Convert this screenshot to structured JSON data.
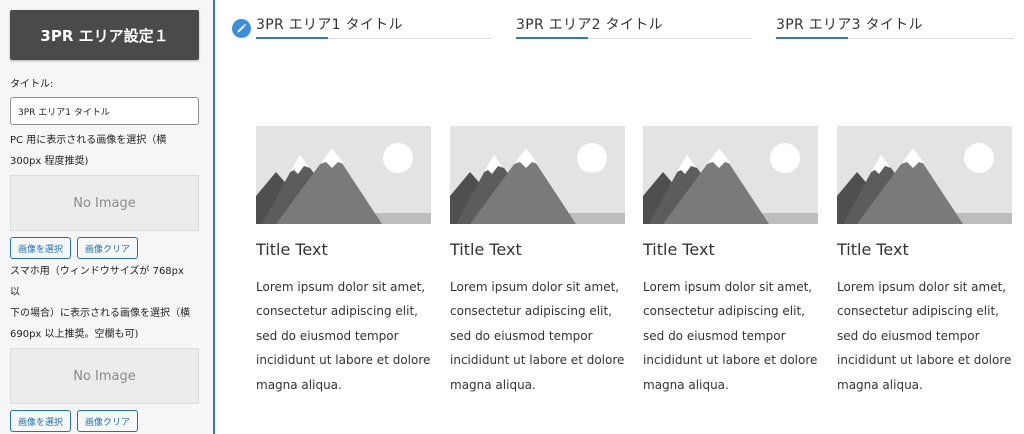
{
  "panel": {
    "heading": "3PR エリア設定１",
    "title_label": "タイトル:",
    "title_value": "3PR エリア1 タイトル",
    "pc_image_label_1": "PC 用に表示される画像を選択（横",
    "pc_image_label_2": "300px 程度推奨)",
    "pc_no_image": "No Image",
    "select_button": "画像を選択",
    "clear_button": "画像クリア",
    "sp_label_1": "スマホ用（ウィンドウサイズが 768px 以",
    "sp_label_2": "下の場合）に表示される画像を選択（横",
    "sp_label_3": "690px 以上推奨。空欄も可)",
    "sp_no_image": "No Image",
    "sp_select_button": "画像を選択",
    "sp_clear_button": "画像クリア"
  },
  "tabs": [
    {
      "label": "3PR エリア1 タイトル"
    },
    {
      "label": "3PR エリア2 タイトル"
    },
    {
      "label": "3PR エリア3 タイトル"
    }
  ],
  "cards": [
    {
      "title": "Title Text",
      "text": "Lorem ipsum dolor sit amet, consectetur adipiscing elit, sed do eiusmod tempor incididunt ut labore et dolore magna aliqua."
    },
    {
      "title": "Title Text",
      "text": "Lorem ipsum dolor sit amet, consectetur adipiscing elit, sed do eiusmod tempor incididunt ut labore et dolore magna aliqua."
    },
    {
      "title": "Title Text",
      "text": "Lorem ipsum dolor sit amet, consectetur adipiscing elit, sed do eiusmod tempor incididunt ut labore et dolore magna aliqua."
    },
    {
      "title": "Title Text",
      "text": "Lorem ipsum dolor sit amet, consectetur adipiscing elit, sed do eiusmod tempor incididunt ut labore et dolore magna aliqua."
    }
  ],
  "icons": {
    "edit": "pencil-icon",
    "placeholder": "mountain-placeholder-icon"
  },
  "colors": {
    "accent": "#2f78c4",
    "panel_heading_bg": "#4a4a4a",
    "button_text": "#2271b1"
  }
}
